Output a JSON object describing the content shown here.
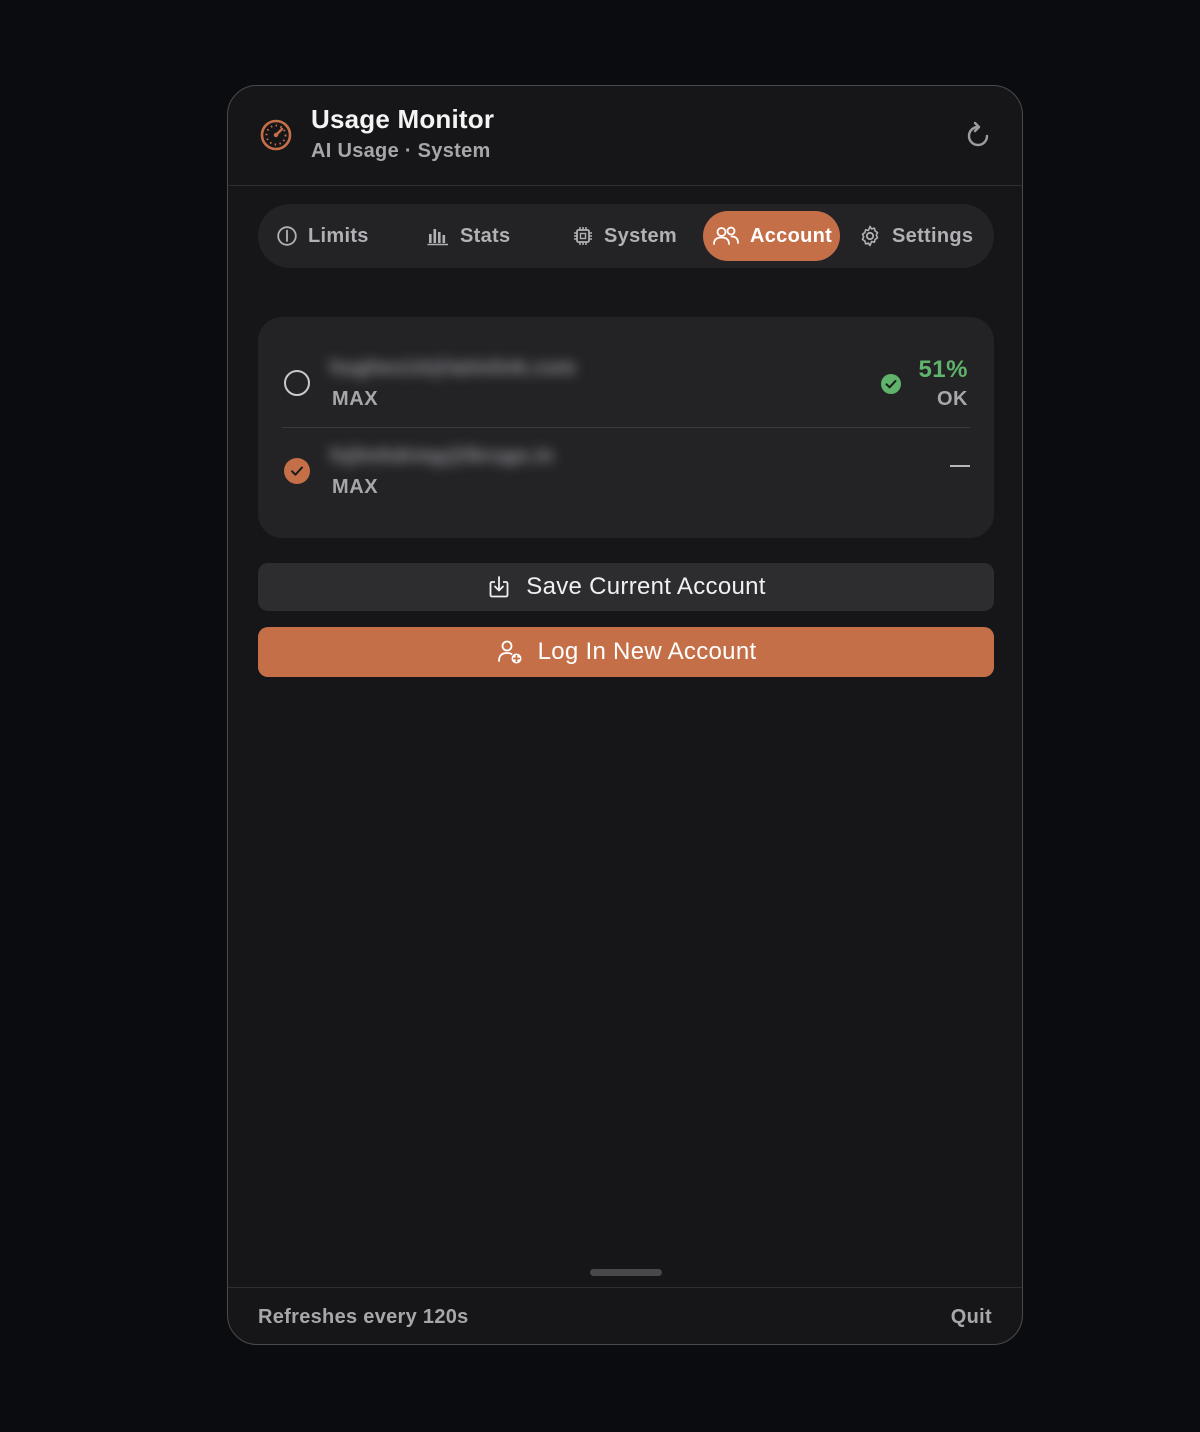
{
  "header": {
    "title": "Usage Monitor",
    "subtitle": "AI Usage · System",
    "app_icon": "speedometer-icon",
    "refresh_icon": "refresh-icon"
  },
  "tabs": [
    {
      "label": "Limits",
      "icon": "gauge-icon",
      "active": false
    },
    {
      "label": "Stats",
      "icon": "bar-chart-icon",
      "active": false
    },
    {
      "label": "System",
      "icon": "cpu-icon",
      "active": false
    },
    {
      "label": "Account",
      "icon": "users-icon",
      "active": true
    },
    {
      "label": "Settings",
      "icon": "gear-icon",
      "active": false
    }
  ],
  "accounts": [
    {
      "email": "hughes14@latinlink.com",
      "plan": "MAX",
      "selected": false,
      "usage": "51%",
      "status": "OK"
    },
    {
      "email": "fsjhnhdrmg@lkrugo.in",
      "plan": "MAX",
      "selected": true,
      "usage": "—",
      "status": ""
    }
  ],
  "actions": {
    "save_label": "Save Current Account",
    "login_label": "Log In New Account"
  },
  "footer": {
    "refresh_note": "Refreshes every 120s",
    "quit_label": "Quit"
  },
  "colors": {
    "accent": "#c46f48",
    "ok_green": "#5fb36a",
    "background": "#161618",
    "card": "#232326"
  }
}
